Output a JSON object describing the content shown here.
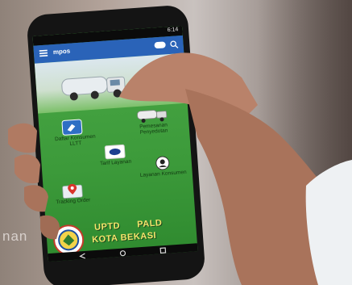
{
  "status_bar": {
    "time": "6:14"
  },
  "app_bar": {
    "title": "mpos"
  },
  "menu": {
    "items": [
      {
        "label": "Daftar Konsumen LLTT"
      },
      {
        "label": "Pemesanan Penyedotan"
      },
      {
        "label": "Tarif Layanan"
      },
      {
        "label": "Layanan Konsumen"
      },
      {
        "label": "Tracking Order"
      }
    ]
  },
  "brand": {
    "line1": "UPTD      PALD",
    "line2": "KOTA BEKASI"
  },
  "background_caption": "nan",
  "colors": {
    "screen_green": "#3c9a3a",
    "app_bar_blue": "#2a63b8",
    "brand_yellow": "#f4e46b"
  }
}
